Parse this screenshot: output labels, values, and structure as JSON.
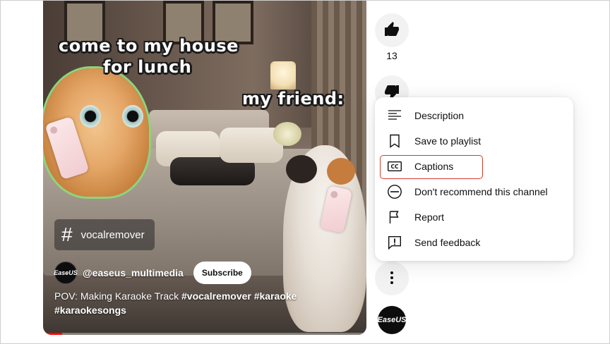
{
  "video": {
    "meme_top": "come to my house",
    "meme_top_2": "for lunch",
    "meme_right": "my friend:",
    "hashtag_chip": "vocalremover",
    "channel_avatar_text": "EaseUS",
    "channel_handle": "@easeus_multimedia",
    "subscribe_label": "Subscribe",
    "title_plain": "POV: Making Karaoke Track ",
    "title_tag_1": "#vocalremover",
    "title_tag_2": "#karaoke",
    "title_tag_3": "#karaokesongs",
    "progress_percent": 6,
    "progress_color": "#ff0000"
  },
  "actions": {
    "like_count": "13",
    "like_icon": "thumbs-up-icon",
    "dislike_icon": "thumbs-down-icon",
    "more_icon": "more-vertical-icon",
    "channel_avatar_text": "EaseUS"
  },
  "menu": {
    "items": [
      {
        "label": "Description",
        "icon": "description-icon"
      },
      {
        "label": "Save to playlist",
        "icon": "bookmark-icon"
      },
      {
        "label": "Captions",
        "icon": "captions-icon",
        "highlighted": true
      },
      {
        "label": "Don't recommend this channel",
        "icon": "block-icon"
      },
      {
        "label": "Report",
        "icon": "flag-icon"
      },
      {
        "label": "Send feedback",
        "icon": "feedback-icon"
      }
    ],
    "highlight_color": "#d33c2c"
  }
}
